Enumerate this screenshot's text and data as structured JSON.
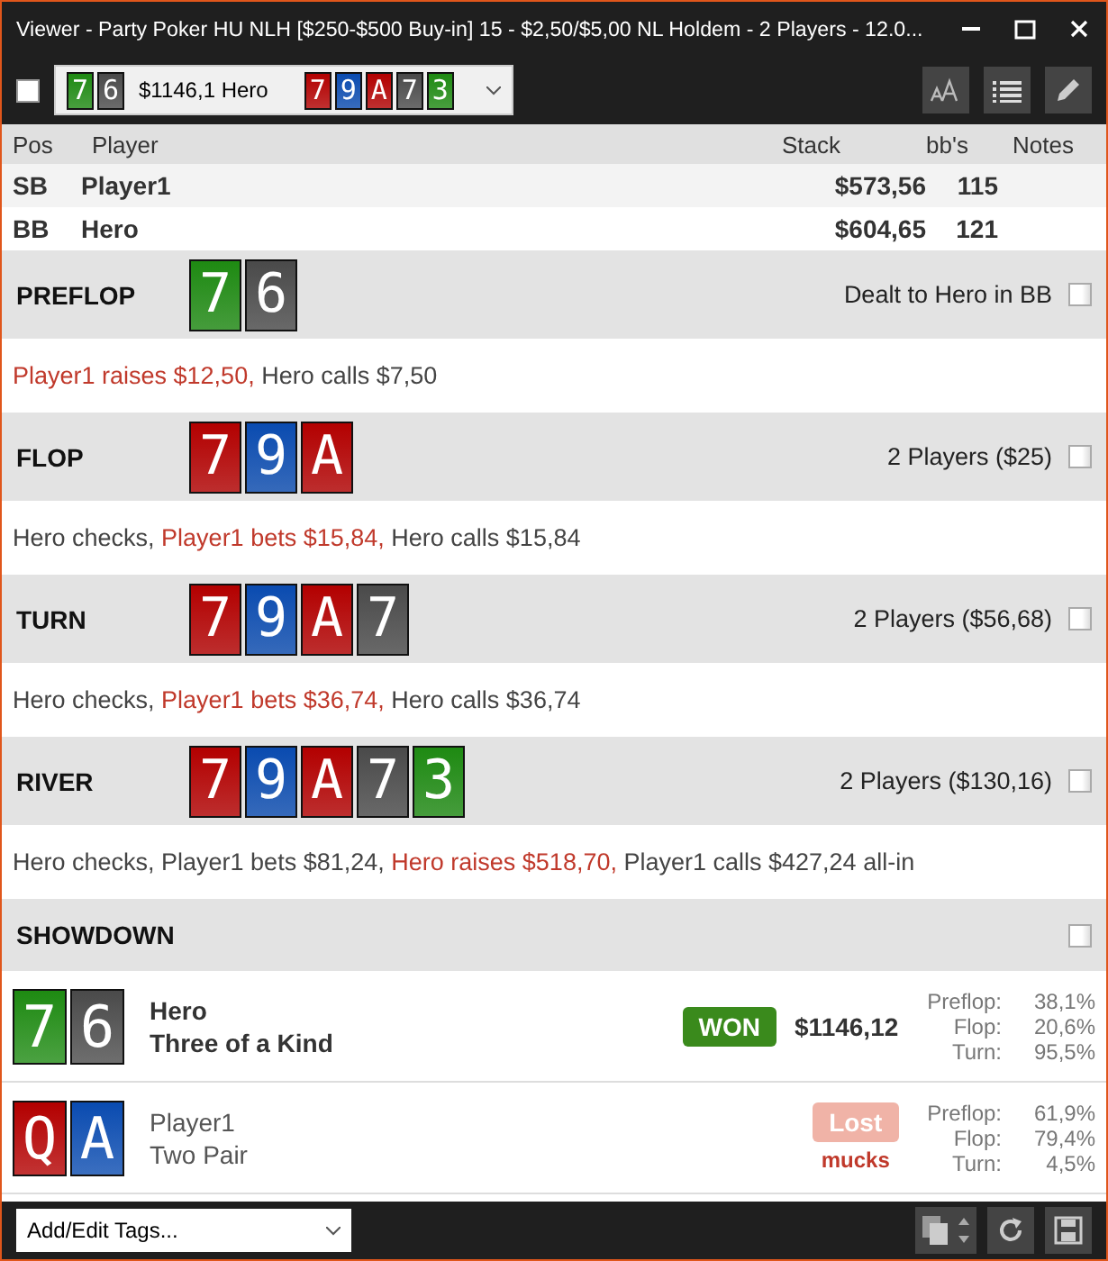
{
  "window": {
    "title": "Viewer - Party Poker HU NLH [$250-$500 Buy-in] 15 - $2,50/$5,00 NL Holdem - 2 Players - 12.0..."
  },
  "toolbar": {
    "checked": false,
    "hand_selector": {
      "hole_cards": [
        {
          "rank": "7",
          "color": "#1e8a12"
        },
        {
          "rank": "6",
          "color": "#4a4a4a"
        }
      ],
      "label": "$1146,1 Hero",
      "board": [
        {
          "rank": "7",
          "color": "#b30000"
        },
        {
          "rank": "9",
          "color": "#0a4bb0"
        },
        {
          "rank": "A",
          "color": "#b30000"
        },
        {
          "rank": "7",
          "color": "#4a4a4a"
        },
        {
          "rank": "3",
          "color": "#1e8a12"
        }
      ]
    }
  },
  "players_table": {
    "columns": [
      "Pos",
      "Player",
      "Stack",
      "bb's",
      "Notes"
    ],
    "rows": [
      {
        "pos": "SB",
        "player": "Player1",
        "stack": "$573,56",
        "bbs": "115"
      },
      {
        "pos": "BB",
        "player": "Hero",
        "stack": "$604,65",
        "bbs": "121"
      }
    ]
  },
  "streets": [
    {
      "name": "PREFLOP",
      "cards": [
        {
          "rank": "7",
          "color": "#1e8a12"
        },
        {
          "rank": "6",
          "color": "#4a4a4a"
        }
      ],
      "info": "Dealt to Hero in BB",
      "checked": false,
      "actions": [
        {
          "text": "Player1 raises $12,50,",
          "highlight": true
        },
        {
          "text": "Hero calls $7,50",
          "highlight": false
        }
      ]
    },
    {
      "name": "FLOP",
      "cards": [
        {
          "rank": "7",
          "color": "#b30000"
        },
        {
          "rank": "9",
          "color": "#0a4bb0"
        },
        {
          "rank": "A",
          "color": "#b30000"
        }
      ],
      "info": "2 Players ($25)",
      "checked": false,
      "actions": [
        {
          "text": "Hero checks,",
          "highlight": false
        },
        {
          "text": "Player1 bets $15,84,",
          "highlight": true
        },
        {
          "text": "Hero calls $15,84",
          "highlight": false
        }
      ]
    },
    {
      "name": "TURN",
      "cards": [
        {
          "rank": "7",
          "color": "#b30000"
        },
        {
          "rank": "9",
          "color": "#0a4bb0"
        },
        {
          "rank": "A",
          "color": "#b30000"
        },
        {
          "rank": "7",
          "color": "#4a4a4a"
        }
      ],
      "info": "2 Players ($56,68)",
      "checked": false,
      "actions": [
        {
          "text": "Hero checks,",
          "highlight": false
        },
        {
          "text": "Player1 bets $36,74,",
          "highlight": true
        },
        {
          "text": "Hero calls $36,74",
          "highlight": false
        }
      ]
    },
    {
      "name": "RIVER",
      "cards": [
        {
          "rank": "7",
          "color": "#b30000"
        },
        {
          "rank": "9",
          "color": "#0a4bb0"
        },
        {
          "rank": "A",
          "color": "#b30000"
        },
        {
          "rank": "7",
          "color": "#4a4a4a"
        },
        {
          "rank": "3",
          "color": "#1e8a12"
        }
      ],
      "info": "2 Players ($130,16)",
      "checked": false,
      "actions": [
        {
          "text": "Hero checks, Player1 bets $81,24,",
          "highlight": false
        },
        {
          "text": "Hero raises $518,70,",
          "highlight": true
        },
        {
          "text": "Player1 calls $427,24 all-in",
          "highlight": false
        }
      ]
    }
  ],
  "showdown": {
    "name": "SHOWDOWN",
    "checked": false,
    "players": [
      {
        "cards": [
          {
            "rank": "7",
            "color": "#1e8a12"
          },
          {
            "rank": "6",
            "color": "#4a4a4a"
          }
        ],
        "name": "Hero",
        "hand": "Three of a Kind",
        "result": {
          "kind": "won",
          "label": "WON"
        },
        "amount": "$1146,12",
        "equity": [
          {
            "label": "Preflop:",
            "value": "38,1%"
          },
          {
            "label": "Flop:",
            "value": "20,6%"
          },
          {
            "label": "Turn:",
            "value": "95,5%"
          }
        ]
      },
      {
        "cards": [
          {
            "rank": "Q",
            "color": "#b30000"
          },
          {
            "rank": "A",
            "color": "#0a4bb0"
          }
        ],
        "name": "Player1",
        "hand": "Two Pair",
        "result": {
          "kind": "lost",
          "label": "Lost",
          "note": "mucks"
        },
        "equity": [
          {
            "label": "Preflop:",
            "value": "61,9%"
          },
          {
            "label": "Flop:",
            "value": "79,4%"
          },
          {
            "label": "Turn:",
            "value": "4,5%"
          }
        ]
      }
    ]
  },
  "footer": {
    "tags_select": "Add/Edit Tags..."
  }
}
